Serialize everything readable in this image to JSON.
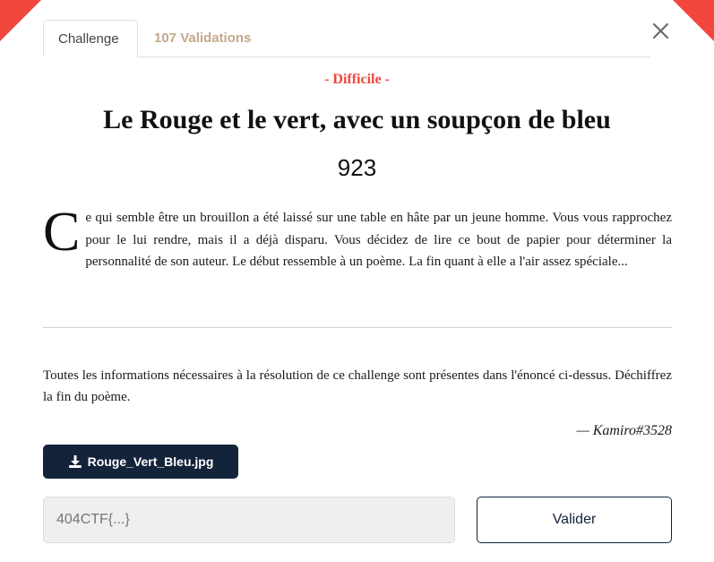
{
  "colors": {
    "accent": "#f0463c",
    "navy": "#13233a",
    "tab_inactive": "#c4a98a"
  },
  "tabs": [
    {
      "label": "Challenge",
      "active": true
    },
    {
      "label": "107 Validations",
      "active": false
    }
  ],
  "close_icon": "close-icon",
  "challenge": {
    "difficulty": "- Difficile -",
    "title": "Le Rouge et le vert, avec un soupçon de bleu",
    "points": "923",
    "description_dropcap": "C",
    "description": "e qui semble être un brouillon a été laissé sur une table en hâte par un jeune homme. Vous vous rapprochez pour le lui rendre, mais il a déjà disparu. Vous décidez de lire ce bout de papier pour déterminer la personnalité de son auteur. Le début ressemble à un poème. La fin quant à elle a l'air assez spéciale...",
    "info": "Toutes les informations nécessaires à la résolution de ce challenge sont présentes dans l'énoncé ci-dessus. Déchiffrez la fin du poème.",
    "author": "— Kamiro#3528"
  },
  "download": {
    "label": "Rouge_Vert_Bleu.jpg",
    "icon": "download-icon"
  },
  "flag_input": {
    "placeholder": "404CTF{...}",
    "value": ""
  },
  "submit": {
    "label": "Valider"
  }
}
